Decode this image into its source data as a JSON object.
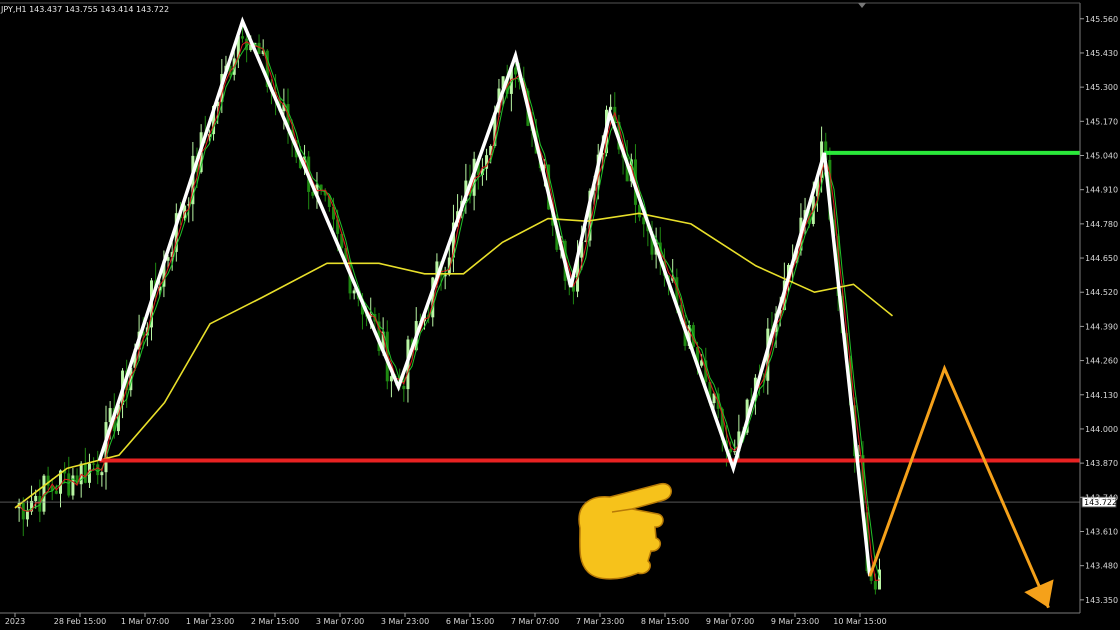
{
  "window": {
    "header_text": "JPY,H1  143.437 143.755 143.414 143.722"
  },
  "colors": {
    "background": "#000000",
    "bull_candle": "#b9f5a4",
    "bear_candle": "#1f8a12",
    "ma_fast": "#e11d1d",
    "ma_mid": "#22c22a",
    "ma_slow": "#e8df2a",
    "zigzag": "#ffffff",
    "resistance": "#2ae83a",
    "support": "#e82222",
    "projection": "#f5a11a",
    "axis_text": "#d8d8d8"
  },
  "icons": {
    "pointer": "pointing-hand-icon",
    "marker": "triangle-down-icon"
  },
  "chart_data": {
    "type": "candlestick",
    "symbol": "JPY",
    "timeframe": "H1",
    "last_price": "143.722",
    "ylim": [
      143.3,
      145.62
    ],
    "y_ticks": [
      "145.560",
      "145.430",
      "145.300",
      "145.170",
      "145.040",
      "144.910",
      "144.780",
      "144.650",
      "144.520",
      "144.390",
      "144.260",
      "144.130",
      "144.000",
      "143.870",
      "143.740",
      "143.610",
      "143.480",
      "143.350"
    ],
    "x_ticks": [
      "2023",
      "28 Feb 15:00",
      "1 Mar 07:00",
      "1 Mar 23:00",
      "2 Mar 15:00",
      "3 Mar 07:00",
      "3 Mar 23:00",
      "6 Mar 15:00",
      "7 Mar 07:00",
      "7 Mar 23:00",
      "8 Mar 15:00",
      "9 Mar 07:00",
      "9 Mar 23:00",
      "10 Mar 15:00"
    ],
    "zigzag": [
      {
        "x": 1.3,
        "y": 143.88
      },
      {
        "x": 3.5,
        "y": 145.55
      },
      {
        "x": 5.9,
        "y": 144.16
      },
      {
        "x": 7.7,
        "y": 145.42
      },
      {
        "x": 8.55,
        "y": 144.54
      },
      {
        "x": 9.15,
        "y": 145.2
      },
      {
        "x": 11.05,
        "y": 143.85
      },
      {
        "x": 12.45,
        "y": 145.05
      },
      {
        "x": 13.15,
        "y": 143.44
      }
    ],
    "projection": [
      {
        "x": 13.15,
        "y": 143.44
      },
      {
        "x": 14.3,
        "y": 144.23
      },
      {
        "x": 15.9,
        "y": 143.32
      }
    ],
    "horizontal_levels": [
      {
        "name": "resistance",
        "value": 145.05,
        "x_start": 12.45
      },
      {
        "name": "support",
        "value": 143.88,
        "x_start": 1.3
      },
      {
        "name": "last-price",
        "value": 143.722,
        "x_start": 0
      }
    ],
    "ma_slow_points": [
      {
        "x": 0.0,
        "y": 143.7
      },
      {
        "x": 0.8,
        "y": 143.85
      },
      {
        "x": 1.6,
        "y": 143.9
      },
      {
        "x": 2.3,
        "y": 144.1
      },
      {
        "x": 3.0,
        "y": 144.4
      },
      {
        "x": 3.8,
        "y": 144.5
      },
      {
        "x": 4.8,
        "y": 144.63
      },
      {
        "x": 5.6,
        "y": 144.63
      },
      {
        "x": 6.3,
        "y": 144.59
      },
      {
        "x": 6.9,
        "y": 144.59
      },
      {
        "x": 7.5,
        "y": 144.71
      },
      {
        "x": 8.2,
        "y": 144.8
      },
      {
        "x": 8.8,
        "y": 144.79
      },
      {
        "x": 9.6,
        "y": 144.82
      },
      {
        "x": 10.4,
        "y": 144.78
      },
      {
        "x": 11.4,
        "y": 144.62
      },
      {
        "x": 12.3,
        "y": 144.52
      },
      {
        "x": 12.9,
        "y": 144.55
      },
      {
        "x": 13.5,
        "y": 144.43
      }
    ]
  }
}
